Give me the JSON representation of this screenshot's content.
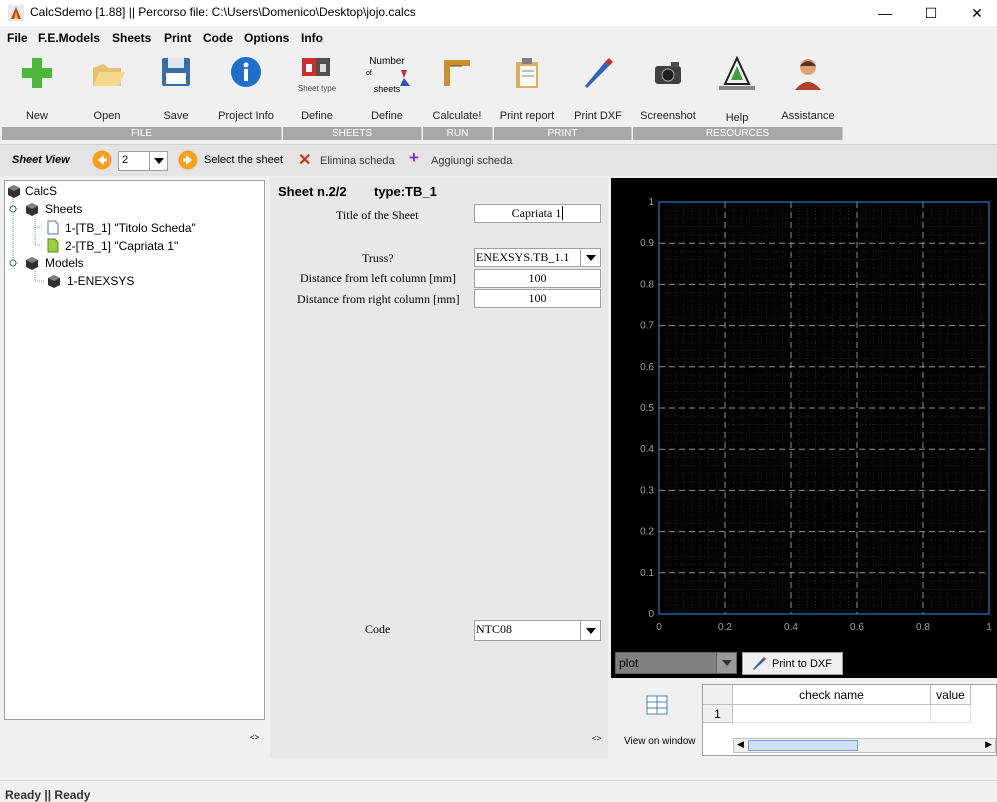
{
  "window": {
    "title": "CalcSdemo [1.88] || Percorso file: C:\\Users\\Domenico\\Desktop\\jojo.calcs",
    "minimize": "—",
    "maximize": "☐",
    "close": "✕"
  },
  "menu": [
    "File",
    "F.E.Models",
    "Sheets",
    "Print",
    "Code",
    "Options",
    "Info"
  ],
  "toolbar": {
    "tools": [
      {
        "label": "New",
        "icon": "plus-icon"
      },
      {
        "label": "Open",
        "icon": "folder-icon"
      },
      {
        "label": "Save",
        "icon": "floppy-icon"
      },
      {
        "label": "Project Info",
        "icon": "info-icon"
      },
      {
        "label": "Define",
        "icon": "sheet-type-icon",
        "caption": "Sheet type"
      },
      {
        "label": "Define",
        "icon": "number-sheets-icon",
        "caption_top": "Number",
        "caption_mid": "of",
        "caption_bot": "sheets"
      },
      {
        "label": "Calculate!",
        "icon": "square-ruler-icon"
      },
      {
        "label": "Print report",
        "icon": "clipboard-icon"
      },
      {
        "label": "Print DXF",
        "icon": "pen-icon"
      },
      {
        "label": "Screenshot",
        "icon": "camera-icon"
      },
      {
        "label": "Help",
        "icon": "tree-logo-icon"
      },
      {
        "label": "Assistance",
        "icon": "assistant-icon"
      }
    ],
    "groups": [
      "FILE",
      "SHEETS",
      "RUN",
      "PRINT",
      "RESOURCES"
    ]
  },
  "sheetbar": {
    "label": "Sheet View",
    "selected_sheet": "2",
    "select_label": "Select the sheet",
    "delete_label": "Elimina scheda",
    "add_label": "Aggiungi scheda"
  },
  "tree": {
    "root": "CalcS",
    "sheets_label": "Sheets",
    "sheets": [
      "1-[TB_1] \"Titolo Scheda\"",
      "2-[TB_1] \"Capriata 1\""
    ],
    "models_label": "Models",
    "models": [
      "1-ENEXSYS"
    ]
  },
  "form": {
    "header_sheet": "Sheet n.2/2",
    "header_type": "type:TB_1",
    "title_label": "Title of the Sheet",
    "title_value": "Capriata 1",
    "truss_label": "Truss?",
    "truss_value": "ENEXSYS.TB_1.1",
    "left_dist_label": "Distance from left column [mm]",
    "left_dist_value": "100",
    "right_dist_label": "Distance from right column [mm]",
    "right_dist_value": "100",
    "code_label": "Code",
    "code_value": "NTC08"
  },
  "plot": {
    "x_ticks": [
      "0",
      "0.2",
      "0.4",
      "0.6",
      "0.8",
      "1"
    ],
    "y_ticks": [
      "0",
      "0.1",
      "0.2",
      "0.3",
      "0.4",
      "0.5",
      "0.6",
      "0.7",
      "0.8",
      "0.9",
      "1"
    ],
    "mode_value": "plot",
    "print_dxf_label": "Print to DXF",
    "axis_color": "#2f8fd8"
  },
  "table": {
    "view_label": "View on window",
    "headers": [
      "check name",
      "value"
    ],
    "rows": [
      {
        "index": "1",
        "name": "",
        "value": ""
      }
    ]
  },
  "status": "Ready || Ready"
}
